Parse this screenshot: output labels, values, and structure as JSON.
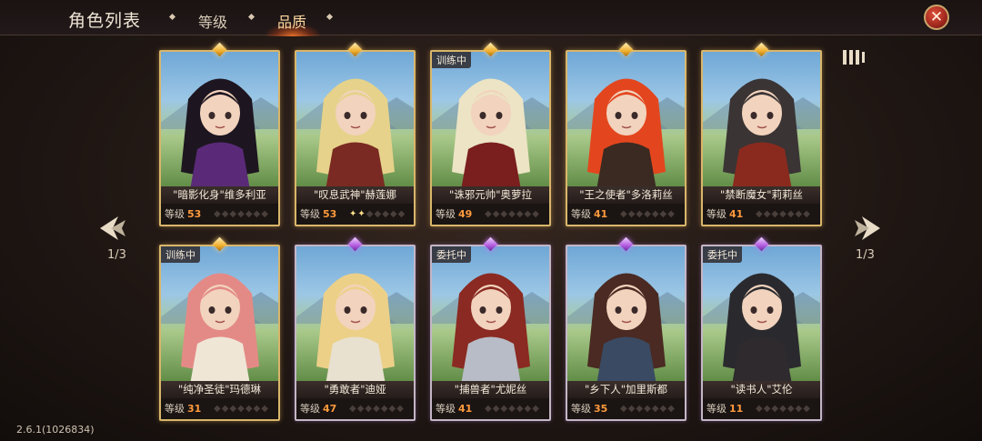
{
  "header": {
    "title": "角色列表",
    "tabs": [
      {
        "label": "等级",
        "active": false
      },
      {
        "label": "品质",
        "active": true
      }
    ],
    "close_icon": "close-icon"
  },
  "pager": {
    "left_indicator": "1/3",
    "right_indicator": "1/3"
  },
  "version": "2.6.1(1026834)",
  "level_label": "等级",
  "accent": "#ff9a3c",
  "cards": [
    {
      "name": "\"暗影化身\"维多利亚",
      "level": "53",
      "status": "",
      "rarity": "gold",
      "stars_lit": 0,
      "hair": "#1d1620",
      "outfit": "#5a2a78"
    },
    {
      "name": "\"叹息武神\"赫莲娜",
      "level": "53",
      "status": "",
      "rarity": "gold",
      "stars_lit": 2,
      "hair": "#e6d28a",
      "outfit": "#7a2a22"
    },
    {
      "name": "\"诛邪元帅\"奥萝拉",
      "level": "49",
      "status": "训练中",
      "rarity": "gold",
      "stars_lit": 0,
      "hair": "#ece4c4",
      "outfit": "#7a1e1e"
    },
    {
      "name": "\"王之使者\"多洛莉丝",
      "level": "41",
      "status": "",
      "rarity": "gold",
      "stars_lit": 0,
      "hair": "#e3461e",
      "outfit": "#3a2a22"
    },
    {
      "name": "\"禁断魔女\"莉莉丝",
      "level": "41",
      "status": "",
      "rarity": "gold",
      "stars_lit": 0,
      "hair": "#3a3434",
      "outfit": "#8a2a1e"
    },
    {
      "name": "\"纯净圣徒\"玛德琳",
      "level": "31",
      "status": "训练中",
      "rarity": "gold",
      "stars_lit": 0,
      "hair": "#e48a86",
      "outfit": "#efe6d6"
    },
    {
      "name": "\"勇敢者\"迪娅",
      "level": "47",
      "status": "",
      "rarity": "purple",
      "stars_lit": 0,
      "hair": "#ecd088",
      "outfit": "#e9e1cf"
    },
    {
      "name": "\"捕兽者\"尤妮丝",
      "level": "41",
      "status": "委托中",
      "rarity": "purple",
      "stars_lit": 0,
      "hair": "#8a2a22",
      "outfit": "#b8bcc6"
    },
    {
      "name": "\"乡下人\"加里斯都",
      "level": "35",
      "status": "",
      "rarity": "purple",
      "stars_lit": 0,
      "hair": "#4a2a22",
      "outfit": "#3a4a62"
    },
    {
      "name": "\"读书人\"艾伦",
      "level": "11",
      "status": "委托中",
      "rarity": "purple",
      "stars_lit": 0,
      "hair": "#2a2a2e",
      "outfit": "#2e2a2e"
    }
  ]
}
